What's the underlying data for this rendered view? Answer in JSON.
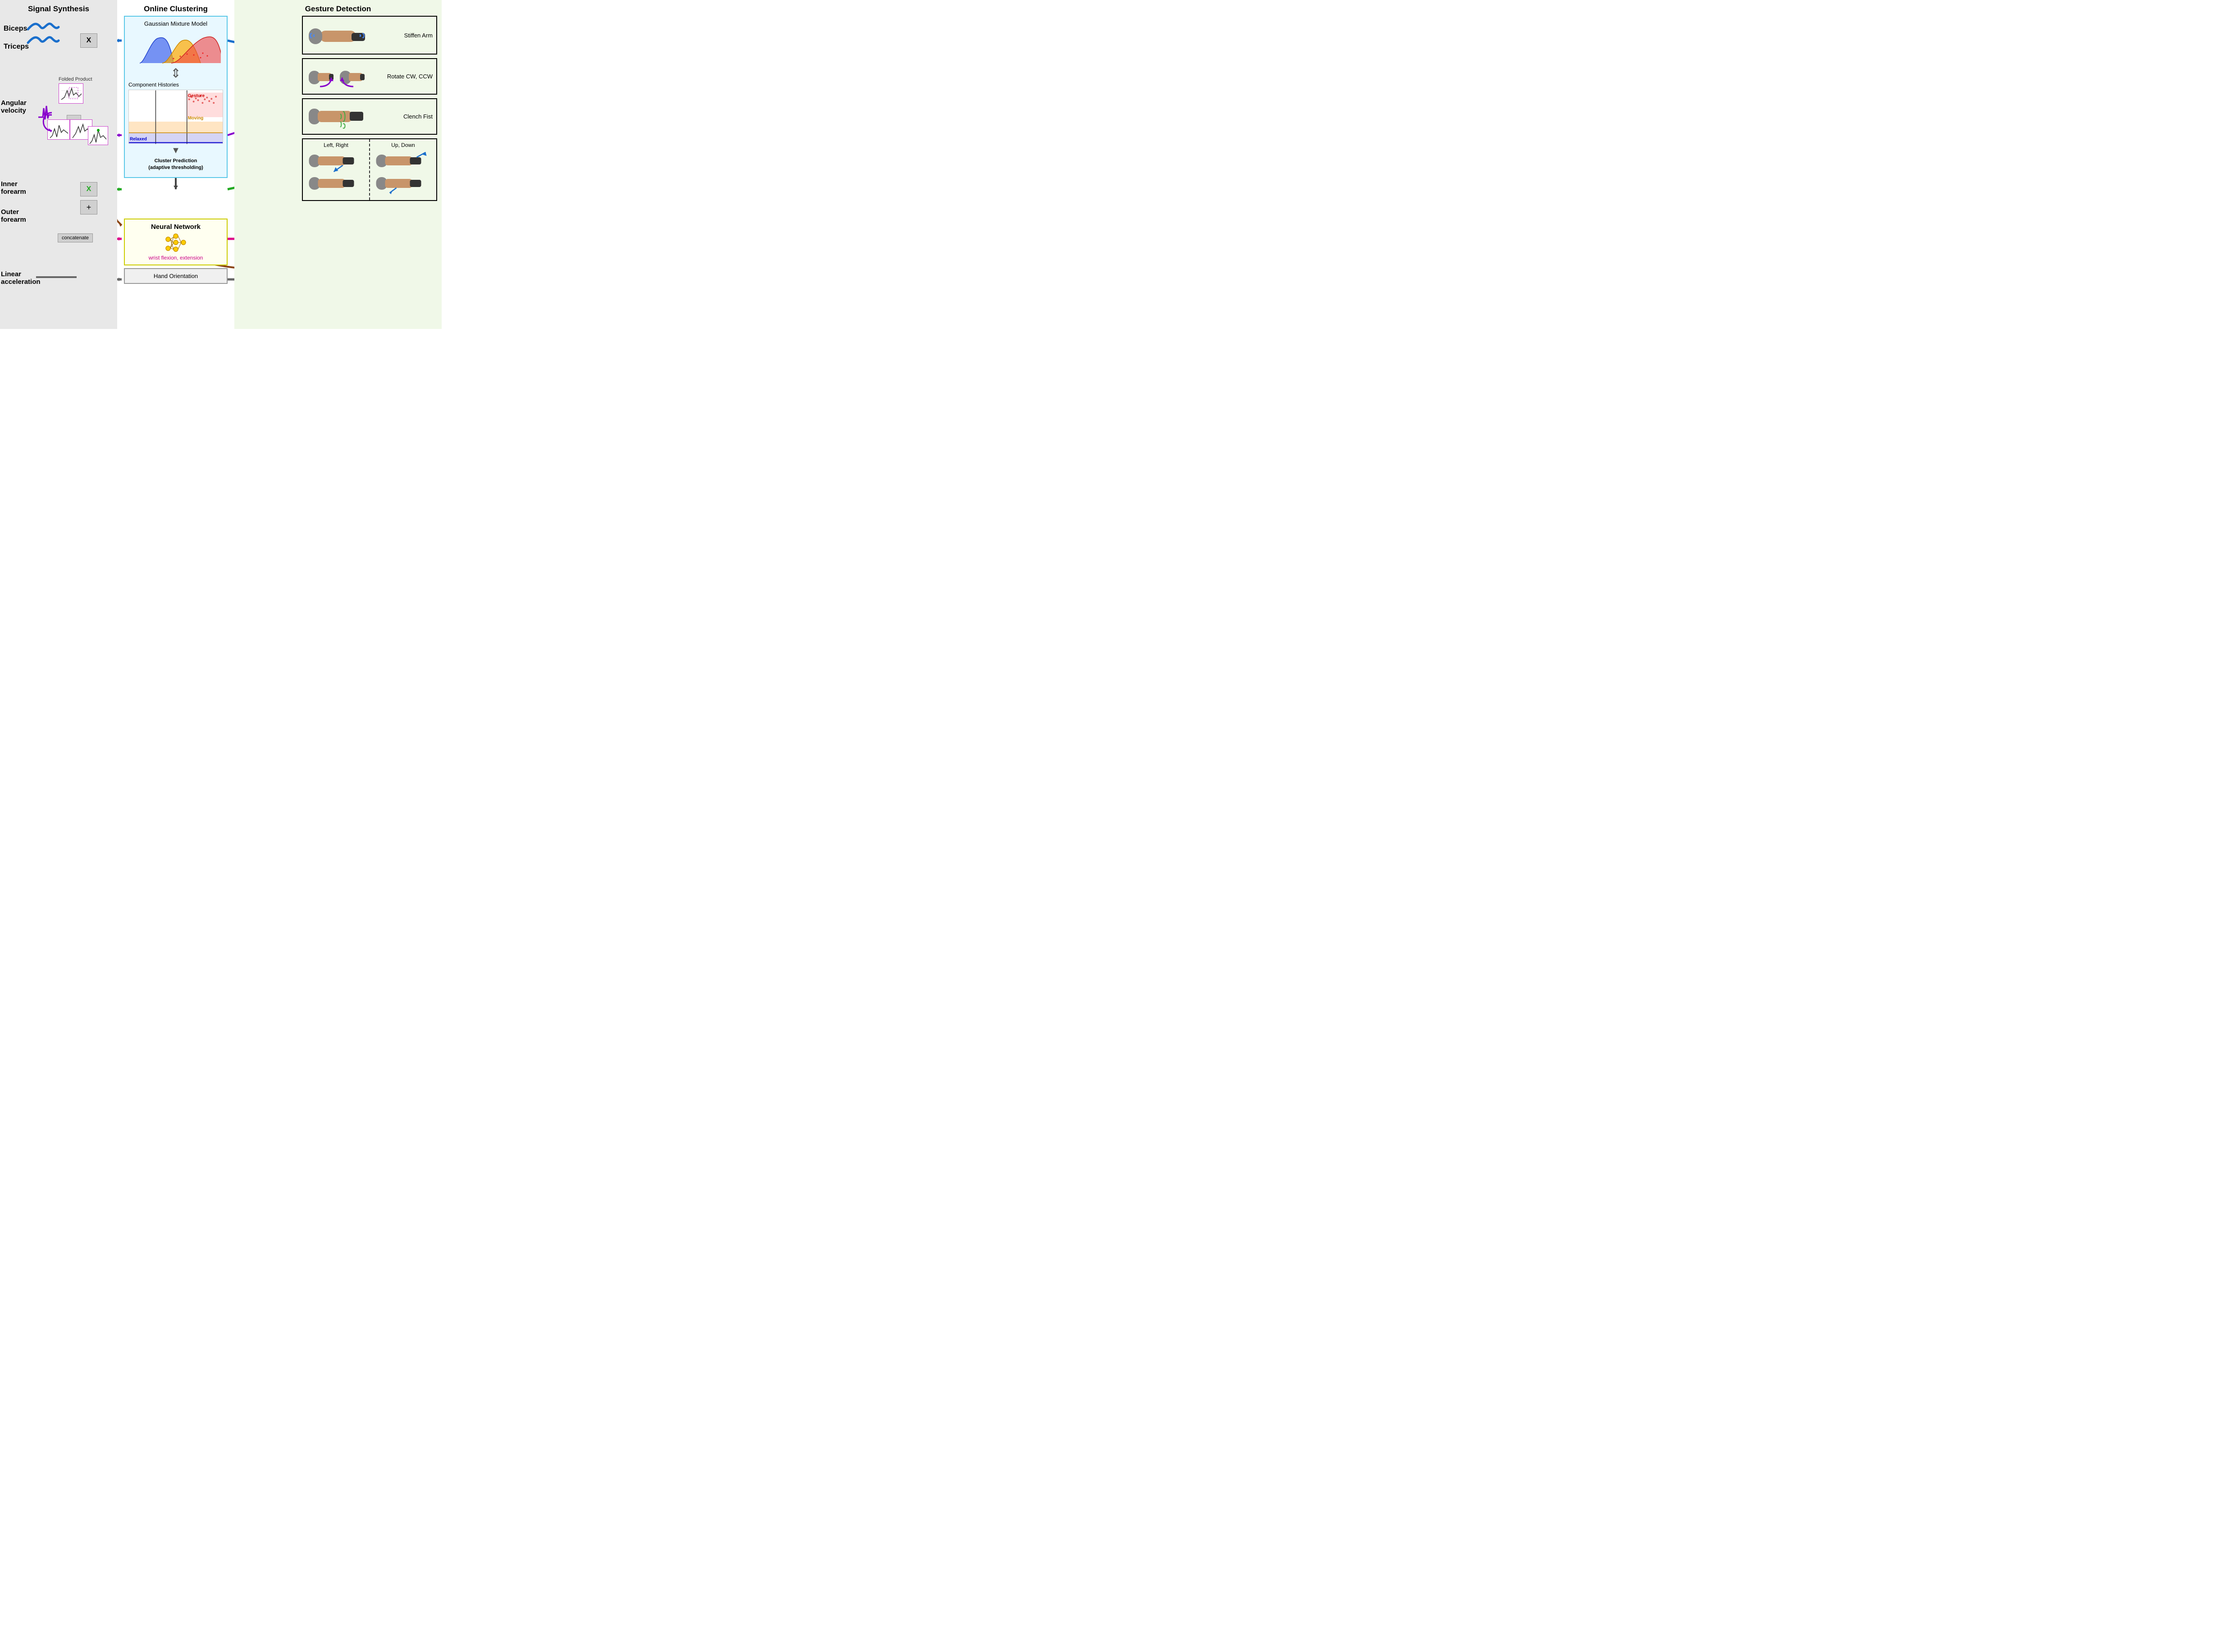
{
  "sections": {
    "signal_synthesis": {
      "title": "Signal Synthesis",
      "background": "#e8e8e8"
    },
    "online_clustering": {
      "title": "Online Clustering"
    },
    "gesture_detection": {
      "title": "Gesture Detection",
      "background": "#f0f8e8"
    }
  },
  "inputs": {
    "biceps": "Biceps",
    "triceps": "Triceps",
    "angular_velocity": "Angular\nvelocity",
    "inner_forearm": "Inner\nforearm",
    "outer_forearm": "Outer\nforearm",
    "linear_acceleration": "Linear\nacceleration"
  },
  "operations": {
    "multiply1": "X",
    "multiply2": "X",
    "plus": "+",
    "concatenate": "concatenate",
    "folded_product": "Folded Product"
  },
  "clustering": {
    "gmm_title": "Gaussian Mixture Model",
    "component_histories_title": "Component Histories",
    "labels": {
      "gesture": "Gesture",
      "moving": "Moving",
      "relaxed": "Relaxed"
    },
    "cluster_prediction": "Cluster Prediction\n(adaptive thresholding)"
  },
  "neural_network": {
    "title": "Neural Network",
    "subtitle": "wrist flexion,\nextension"
  },
  "hand_orientation": {
    "label": "Hand Orientation"
  },
  "gestures": {
    "stiffen_arm": "Stiffen Arm",
    "rotate_cw_ccw": "Rotate CW, CCW",
    "clench_fist": "Clench Fist",
    "left_right": "Left, Right",
    "up_down": "Up, Down"
  },
  "colors": {
    "blue": "#1a6fcc",
    "purple": "#8800cc",
    "green": "#22aa22",
    "pink": "#dd0088",
    "brown": "#8B4513",
    "gray": "#666666",
    "cyan_border": "#5bc8e8",
    "yellow_border": "#cccc00",
    "light_green_bg": "#f0f8e8"
  }
}
